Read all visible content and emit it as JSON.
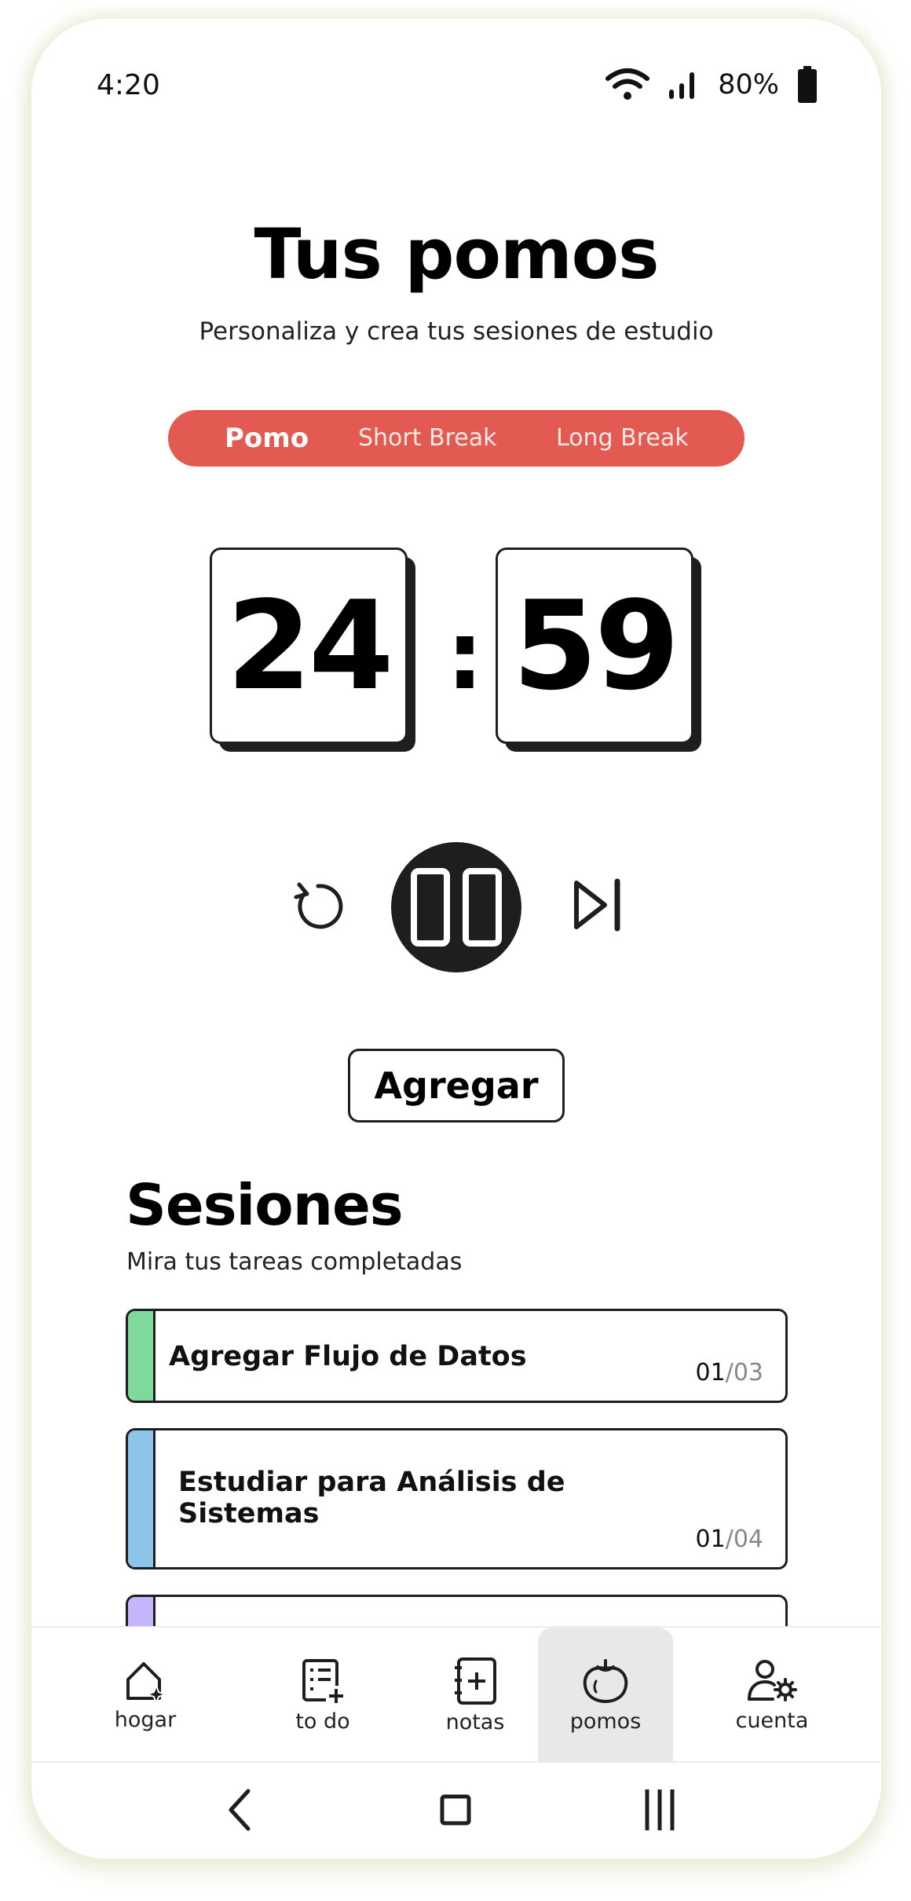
{
  "status_bar": {
    "time": "4:20",
    "battery_percent": "80%"
  },
  "header": {
    "title": "Tus pomos",
    "subtitle": "Personaliza y crea tus sesiones de estudio"
  },
  "mode_tabs": [
    {
      "label": "Pomo",
      "active": true
    },
    {
      "label": "Short Break",
      "active": false
    },
    {
      "label": "Long Break",
      "active": false
    }
  ],
  "timer": {
    "minutes": "24",
    "separator": ":",
    "seconds": "59"
  },
  "controls": {
    "restart_icon": "restart-icon",
    "pause_icon": "pause-icon",
    "skip_icon": "skip-next-icon"
  },
  "add_button": {
    "label": "Agregar"
  },
  "sessions": {
    "title": "Sesiones",
    "subtitle": "Mira tus tareas completadas",
    "items": [
      {
        "title": "Agregar Flujo de Datos",
        "done": "01",
        "total": "/03",
        "color": "#7fd99a"
      },
      {
        "title": "Estudiar para Análisis de Sistemas",
        "done": "01",
        "total": "/04",
        "color": "#8cc4ea"
      },
      {
        "title": "",
        "done": "",
        "total": "",
        "color": "#c5b6fb"
      }
    ]
  },
  "bottom_nav": [
    {
      "label": "hogar",
      "icon": "home-sparkle-icon",
      "active": false
    },
    {
      "label": "to do",
      "icon": "checklist-add-icon",
      "active": false
    },
    {
      "label": "notas",
      "icon": "notebook-add-icon",
      "active": false
    },
    {
      "label": "pomos",
      "icon": "tomato-icon",
      "active": true
    },
    {
      "label": "cuenta",
      "icon": "user-settings-icon",
      "active": false
    }
  ],
  "colors": {
    "accent": "#e25a52",
    "dark": "#1e1e20"
  }
}
